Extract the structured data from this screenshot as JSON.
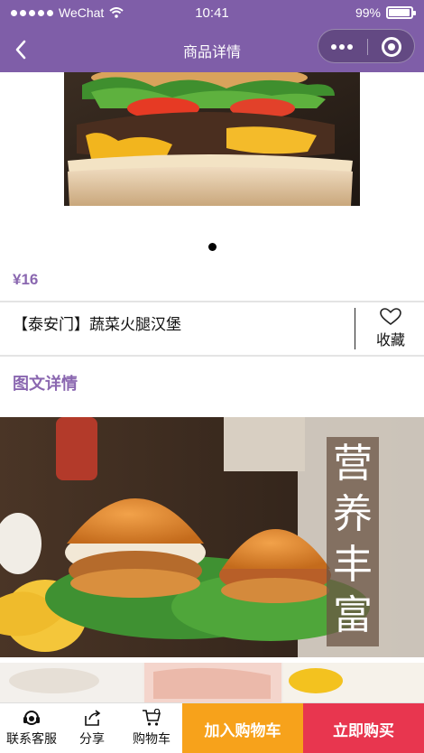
{
  "status": {
    "carrier": "WeChat",
    "time": "10:41",
    "battery": "99%"
  },
  "nav": {
    "title": "商品详情"
  },
  "product": {
    "price": "¥16",
    "name": "【泰安门】蔬菜火腿汉堡",
    "favorite_label": "收藏",
    "slides_total": 1,
    "slide_active": 1
  },
  "detail": {
    "section_title": "图文详情",
    "banner_text": [
      "营",
      "养",
      "丰",
      "富"
    ]
  },
  "toolbar": {
    "service_label": "联系客服",
    "share_label": "分享",
    "cart_label": "购物车",
    "add_cart_label": "加入购物车",
    "buy_label": "立即购买"
  },
  "colors": {
    "accent": "#7f5ea8",
    "price": "#8a67b0",
    "add_cart": "#f7a21b",
    "buy": "#e8364f"
  }
}
